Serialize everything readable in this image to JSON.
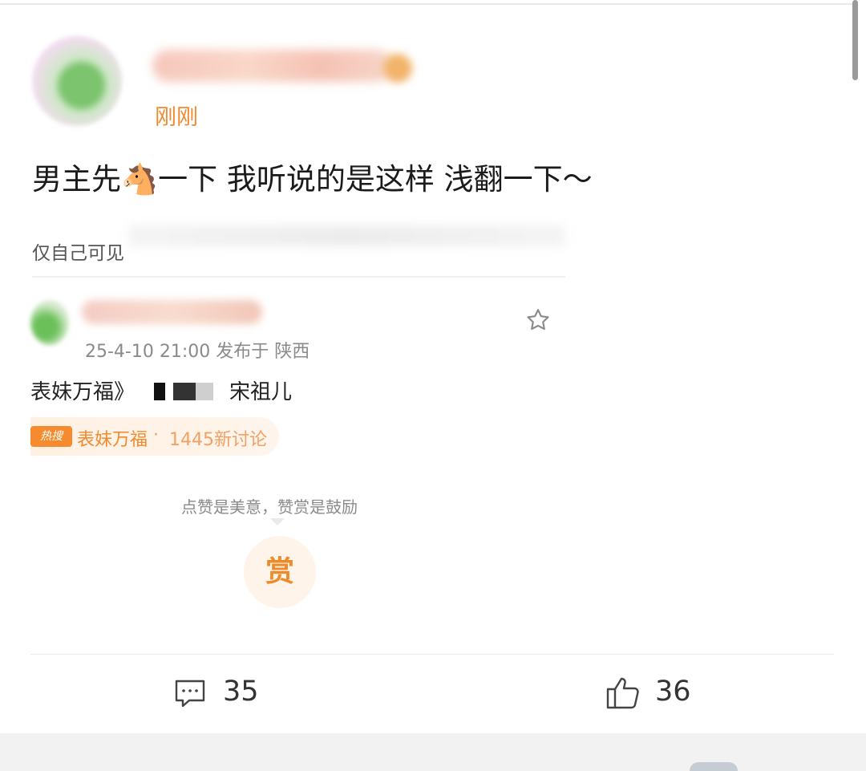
{
  "post": {
    "time": "刚刚",
    "text_before": "男主先",
    "emoji": "🐴",
    "text_after": "一下 我听说的是这样 浅翻一下～",
    "visibility": "仅自己可见"
  },
  "quoted": {
    "meta": "25-4-10 21:00  发布于 陕西",
    "text_start": "表妹万福》",
    "text_end": "宋祖儿",
    "hot_badge": "热搜",
    "hot_topic": "表妹万福",
    "hot_sep": "·",
    "hot_count": "1445新讨论"
  },
  "reward": {
    "prompt": "点赞是美意，赞赏是鼓励",
    "button": "赏"
  },
  "actions": {
    "comment_count": "35",
    "like_count": "36"
  },
  "colors": {
    "accent": "#f08a2f",
    "text": "#1b1b1b",
    "muted": "#8a8a8a"
  },
  "icons": [
    "star-icon",
    "comment-icon",
    "thumbs-up-icon"
  ]
}
